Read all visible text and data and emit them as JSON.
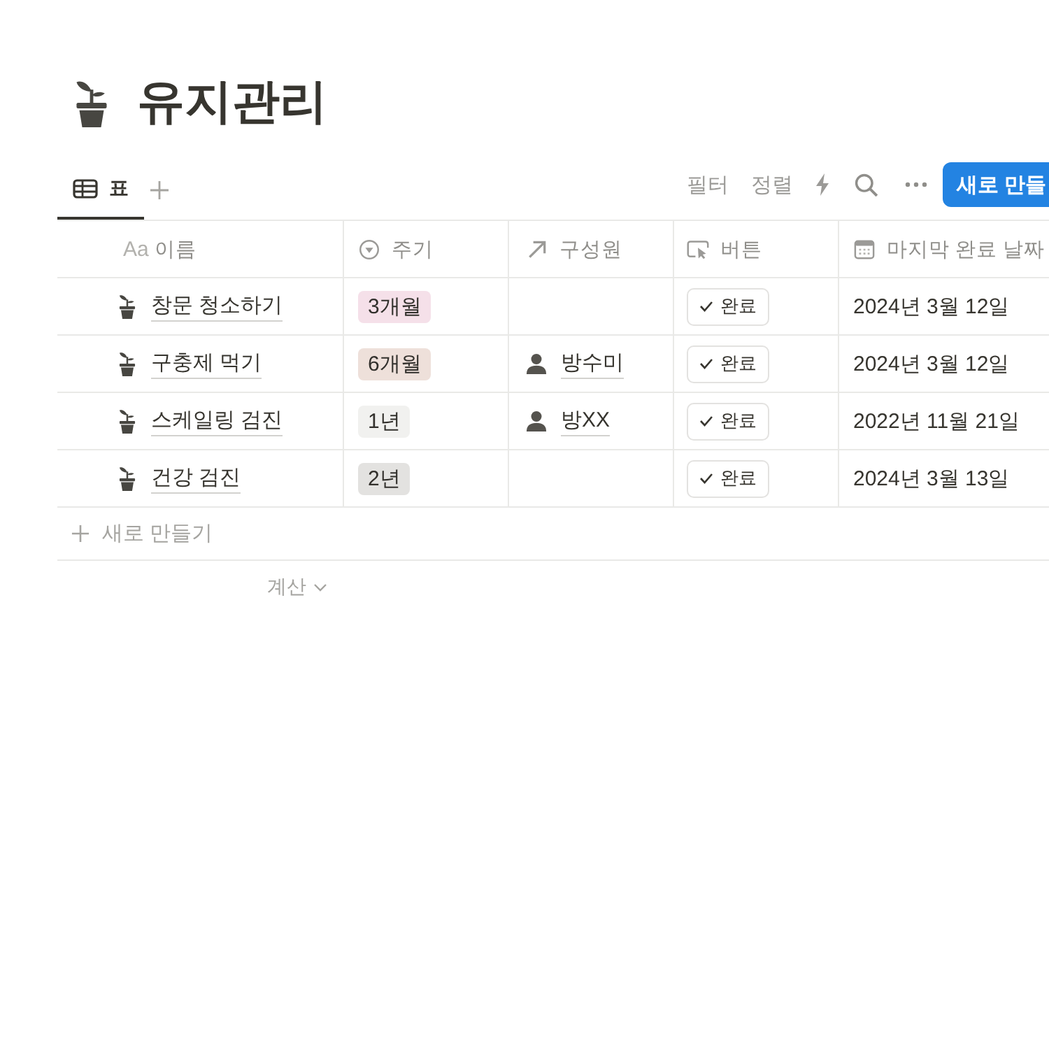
{
  "page": {
    "title": "유지관리"
  },
  "views": [
    {
      "label": "표",
      "selected": true
    }
  ],
  "toolbar": {
    "filter": "필터",
    "sort": "정렬",
    "new_button": "새로 만들"
  },
  "table": {
    "columns": [
      {
        "kind": "title",
        "glyph": "Aa",
        "label": "이름"
      },
      {
        "kind": "select",
        "label": "주기"
      },
      {
        "kind": "relation",
        "label": "구성원"
      },
      {
        "kind": "button",
        "label": "버튼"
      },
      {
        "kind": "date",
        "label": "마지막 완료 날짜"
      }
    ],
    "rows": [
      {
        "name": "창문 청소하기",
        "period": {
          "label": "3개월",
          "color": "#f5e0e9"
        },
        "button": "완료",
        "date": "2024년 3월 12일"
      },
      {
        "name": "구충제 먹기",
        "period": {
          "label": "6개월",
          "color": "#eee0da"
        },
        "member": "방수미",
        "button": "완료",
        "date": "2024년 3월 12일"
      },
      {
        "name": "스케일링 검진",
        "period": {
          "label": "1년",
          "color": "#f1f1ef"
        },
        "member": "방XX",
        "button": "완료",
        "date": "2022년 11월 21일"
      },
      {
        "name": "건강 검진",
        "period": {
          "label": "2년",
          "color": "#e3e2e0"
        },
        "button": "완료",
        "date": "2024년 3월 13일"
      }
    ],
    "add_row": "새로 만들기",
    "calculate": "계산"
  }
}
